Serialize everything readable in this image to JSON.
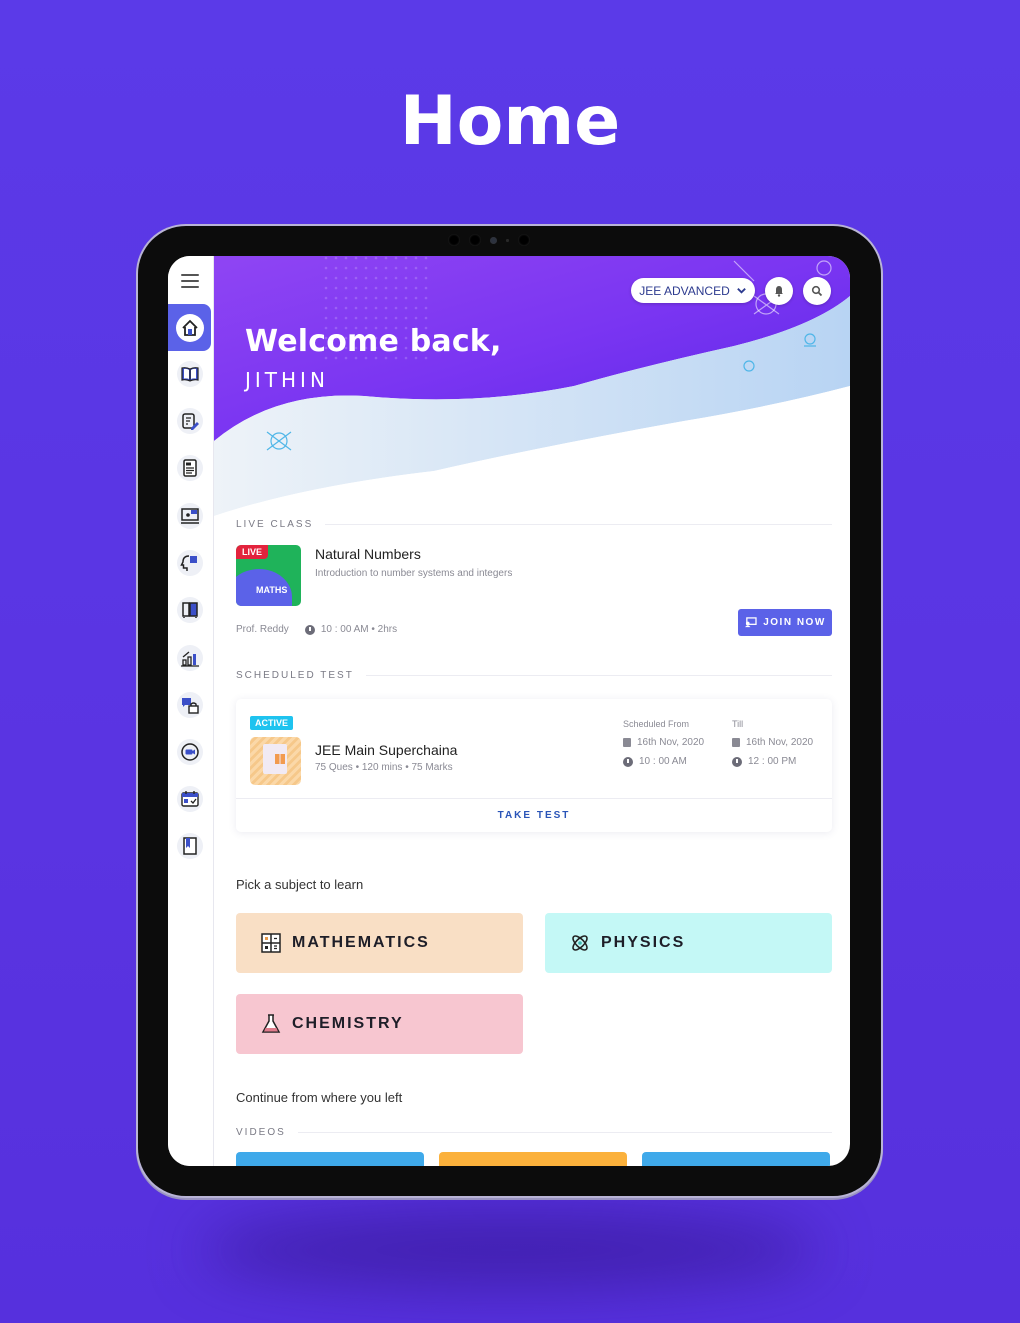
{
  "page": {
    "title": "Home"
  },
  "sidebar": {
    "menu_icon": "hamburger-menu-icon",
    "items": [
      {
        "name": "home",
        "icon": "home-icon",
        "active": true
      },
      {
        "name": "library",
        "icon": "book-icon",
        "active": false
      },
      {
        "name": "assignments",
        "icon": "edit-document-icon",
        "active": false
      },
      {
        "name": "results",
        "icon": "report-card-icon",
        "active": false
      },
      {
        "name": "live-classes",
        "icon": "online-class-icon",
        "active": false
      },
      {
        "name": "doubts",
        "icon": "thinking-head-icon",
        "active": false
      },
      {
        "name": "lockers",
        "icon": "locker-icon",
        "active": false
      },
      {
        "name": "analytics",
        "icon": "bar-chart-icon",
        "active": false
      },
      {
        "name": "chat",
        "icon": "chat-lock-icon",
        "active": false
      },
      {
        "name": "videos",
        "icon": "video-camera-icon",
        "active": false
      },
      {
        "name": "calendar",
        "icon": "calendar-icon",
        "active": false
      },
      {
        "name": "bookmarks",
        "icon": "bookmark-book-icon",
        "active": false
      }
    ]
  },
  "header": {
    "welcome": "Welcome back,",
    "user_name": "JITHIN",
    "exam_selector": "JEE ADVANCED",
    "notification_icon": "bell-icon",
    "search_icon": "search-icon"
  },
  "live_class": {
    "section_label": "LIVE CLASS",
    "badge": "LIVE",
    "subject_tag": "MATHS",
    "title": "Natural Numbers",
    "description": "Introduction to number systems and integers",
    "teacher": "Prof. Reddy",
    "time": "10 : 00 AM • 2hrs",
    "join_button": "JOIN NOW"
  },
  "scheduled_test": {
    "section_label": "SCHEDULED TEST",
    "badge": "ACTIVE",
    "title": "JEE Main Superchaina",
    "meta": "75 Ques • 120 mins • 75 Marks",
    "from_label": "Scheduled From",
    "from_date": "16th Nov, 2020",
    "from_time": "10 : 00 AM",
    "till_label": "Till",
    "till_date": "16th Nov, 2020",
    "till_time": "12 : 00 PM",
    "action": "TAKE TEST"
  },
  "subjects": {
    "heading": "Pick a subject to learn",
    "items": [
      {
        "label": "MATHEMATICS",
        "icon": "calculator-icon",
        "color": "#f9dfc5"
      },
      {
        "label": "PHYSICS",
        "icon": "atom-icon",
        "color": "#c4f8f6"
      },
      {
        "label": "CHEMISTRY",
        "icon": "flask-icon",
        "color": "#f7c6d0"
      }
    ]
  },
  "continue": {
    "heading": "Continue from where you left",
    "videos_label": "VIDEOS",
    "video_colors": [
      "#3fa9ea",
      "#fbb13c",
      "#3fa9ea"
    ]
  },
  "colors": {
    "background": "#5a36e4",
    "accent": "#5b62e8",
    "live_red": "#e3233d",
    "active_cyan": "#1ec3ef",
    "link_blue": "#2a55b8"
  }
}
